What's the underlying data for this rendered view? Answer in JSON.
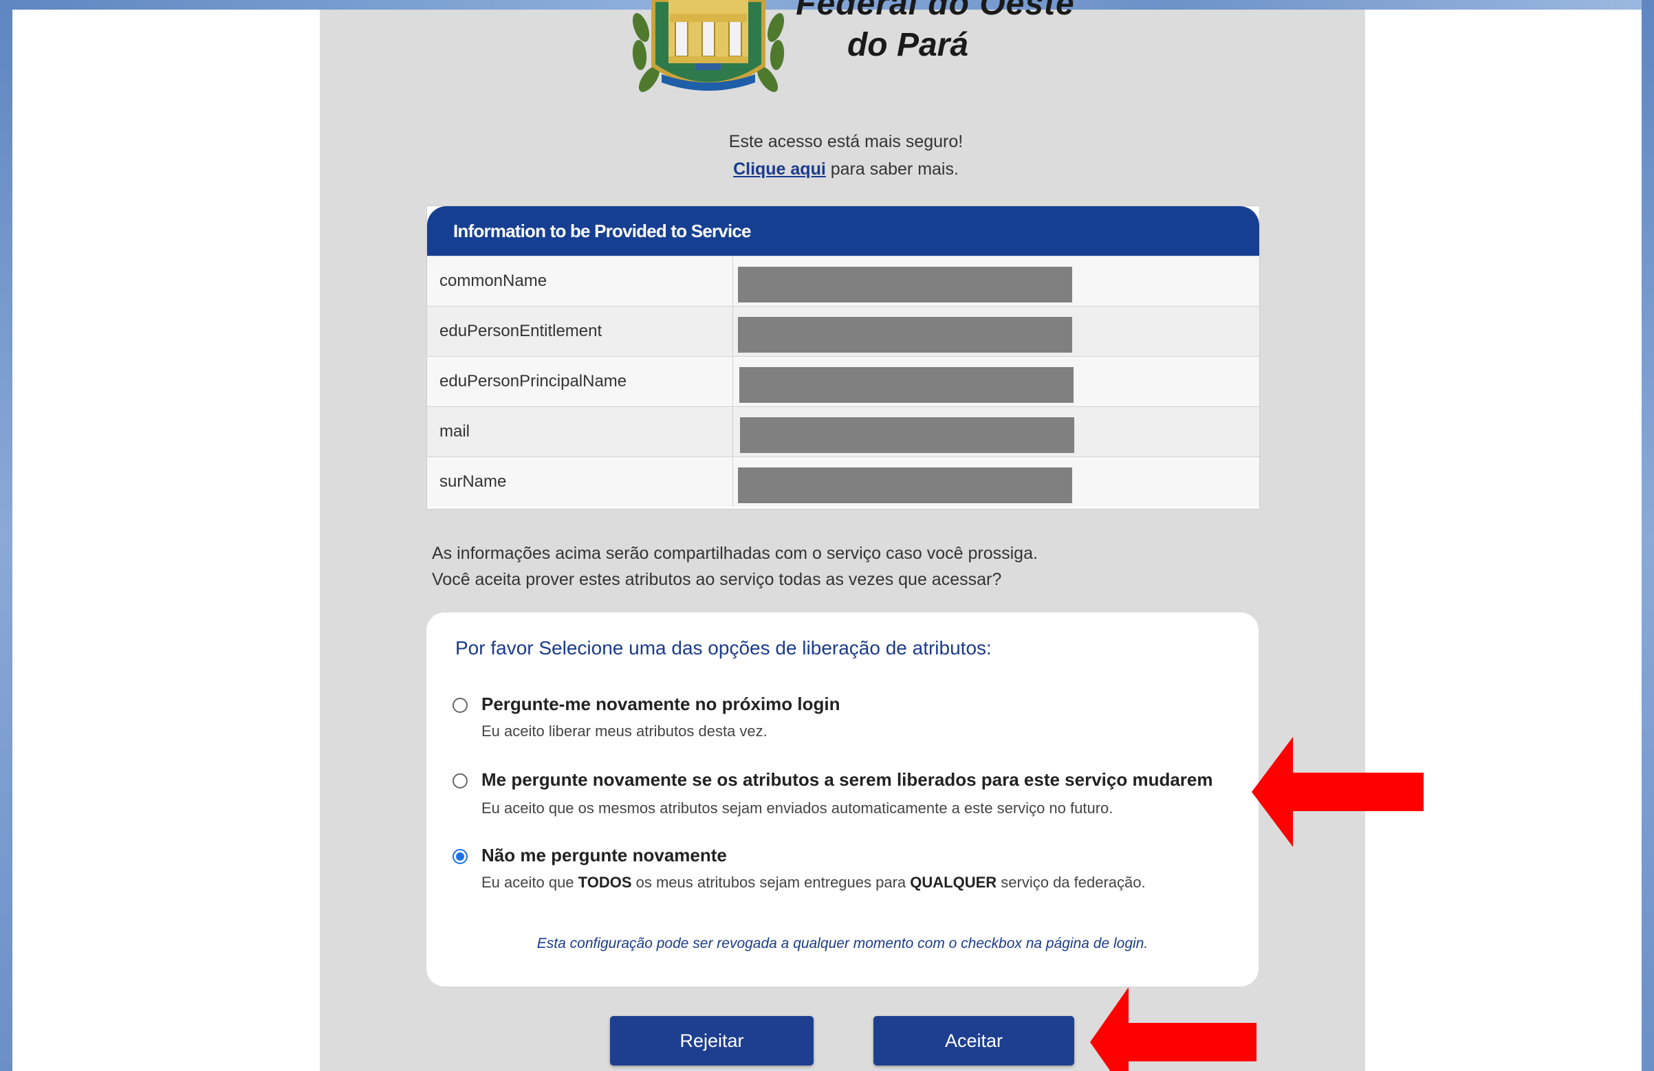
{
  "header": {
    "title_line1": "Federal do Oeste",
    "title_line2": "do Pará"
  },
  "security": {
    "message": "Este acesso está mais seguro!",
    "link_label": "Clique aqui",
    "link_suffix": " para saber mais."
  },
  "attributes": {
    "header": "Information to be Provided to Service",
    "rows": [
      {
        "name": "commonName"
      },
      {
        "name": "eduPersonEntitlement"
      },
      {
        "name": "eduPersonPrincipalName"
      },
      {
        "name": "mail"
      },
      {
        "name": "surName"
      }
    ]
  },
  "info": {
    "line1": "As informações acima serão compartilhadas com o serviço caso você prossiga.",
    "line2": "Você aceita prover estes atributos ao serviço todas as vezes que acessar?"
  },
  "options": {
    "title": "Por favor Selecione uma das opções de liberação de atributos:",
    "items": [
      {
        "label": "Pergunte-me novamente no próximo login",
        "desc": "Eu aceito liberar meus atributos desta vez.",
        "checked": false
      },
      {
        "label": "Me pergunte novamente se os atributos a serem liberados para este serviço mudarem",
        "desc": "Eu aceito que os mesmos atributos sejam enviados automaticamente a este serviço no futuro.",
        "checked": false
      },
      {
        "label": "Não me pergunte novamente",
        "desc_prefix": "Eu aceito que ",
        "desc_bold1": "TODOS",
        "desc_mid": " os meus atritubos sejam entregues para ",
        "desc_bold2": "QUALQUER",
        "desc_suffix": " serviço da federação.",
        "checked": true
      }
    ],
    "note": "Esta configuração pode ser revogada a qualquer momento com o checkbox na página de login."
  },
  "buttons": {
    "reject": "Rejeitar",
    "accept": "Aceitar"
  },
  "colors": {
    "primary": "#1e3f8f",
    "header_blue": "#173f91",
    "arrow_red": "#ff0000",
    "radio_checked": "#1a73e8"
  }
}
